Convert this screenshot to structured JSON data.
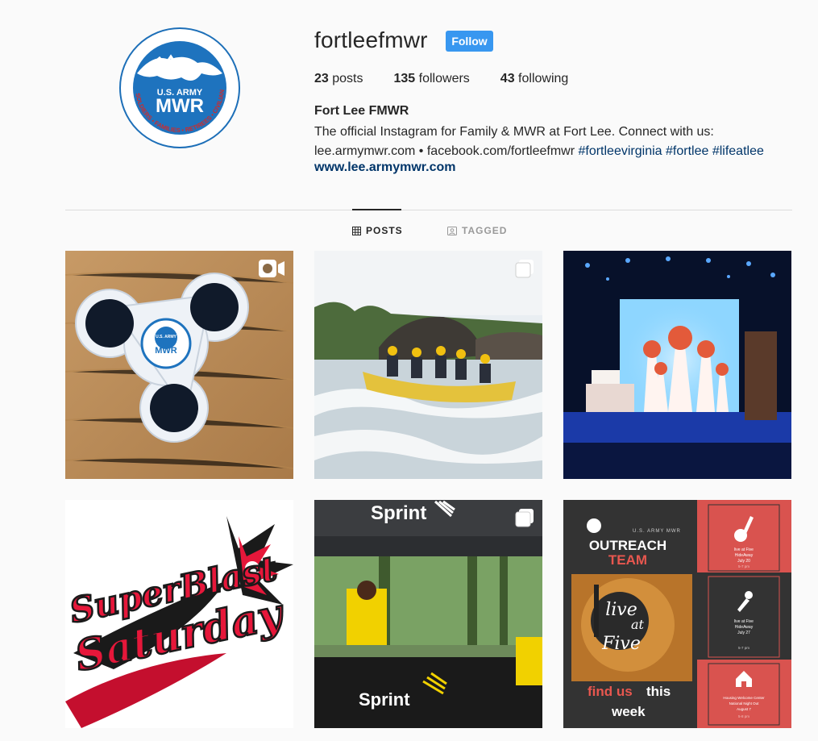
{
  "profile": {
    "username": "fortleefmwr",
    "follow_label": "Follow",
    "stats": [
      {
        "count": "23",
        "label": "posts"
      },
      {
        "count": "135",
        "label": "followers"
      },
      {
        "count": "43",
        "label": "following"
      }
    ],
    "full_name": "Fort Lee FMWR",
    "bio_line1": "The official Instagram for Family & MWR at Fort Lee. Connect with us:",
    "bio_line2_text": "lee.armymwr.com • facebook.com/fortleefmwr",
    "hashtags": [
      "#fortleevirginia",
      "#fortlee",
      "#lifeatlee"
    ],
    "website": "www.lee.armymwr.com",
    "logo": {
      "top": "U.S. ARMY",
      "main": "MWR",
      "ring": "SOLDIERS • FAMILIES • RETIREES • CIVILIANS"
    }
  },
  "tabs": [
    {
      "label": "POSTS",
      "icon": "grid-icon",
      "active": true
    },
    {
      "label": "TAGGED",
      "icon": "tag-icon",
      "active": false
    }
  ],
  "posts": [
    {
      "subject": "fidget spinner",
      "overlay_icon": "video-icon",
      "text": {
        "logo_top": "U.S. ARMY",
        "logo_main": "MWR"
      }
    },
    {
      "subject": "whitewater rafting",
      "overlay_icon": "carousel-icon"
    },
    {
      "subject": "theater stage",
      "overlay_icon": null
    },
    {
      "subject": "superblast saturday",
      "overlay_icon": null,
      "text": {
        "line1": "SuperBlast",
        "line2": "Saturday"
      }
    },
    {
      "subject": "sprint tent booth",
      "overlay_icon": "carousel-icon",
      "text": {
        "canopy": "Sprint",
        "table": "Sprint"
      }
    },
    {
      "subject": "outreach team",
      "overlay_icon": null,
      "text": {
        "org": "U.S. ARMY MWR",
        "title_line1": "OUTREACH",
        "title_line2": "TEAM",
        "live1": "live",
        "live2": "at",
        "live3": "Five",
        "find_us": "find us",
        "this": "this",
        "week": "week",
        "event1": [
          "live at Five",
          "HideAway",
          "July 20",
          "5-7 pm"
        ],
        "event2": [
          "live at Five",
          "HideAway",
          "July 27",
          "5-7 pm"
        ],
        "event3": [
          "Housing Welcome Center",
          "National Night Out",
          "August 7",
          "5-8 pm"
        ]
      }
    }
  ],
  "colors": {
    "follow_blue": "#3897f0",
    "link_blue": "#003569",
    "divider": "#dbdbdb",
    "outreach_red": "#d9534f",
    "outreach_dark": "#333333"
  }
}
